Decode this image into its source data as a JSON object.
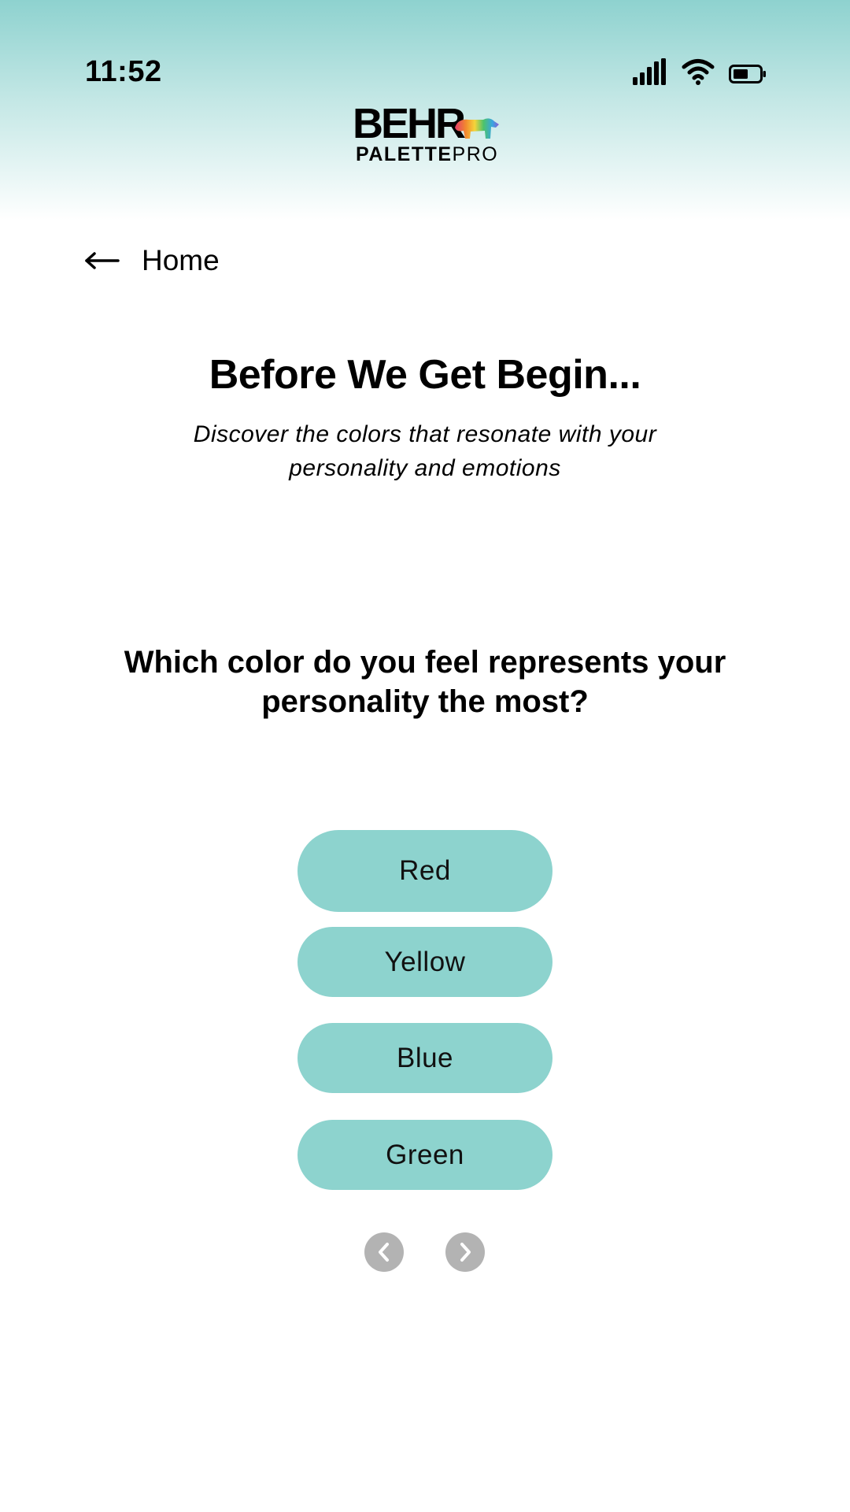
{
  "status_bar": {
    "time": "11:52",
    "icons": [
      "cellular-signal-icon",
      "wifi-icon",
      "battery-icon"
    ]
  },
  "header": {
    "logo": {
      "brand": "BEHR",
      "product_bold": "PALETTE",
      "product_light": "PRO"
    },
    "gradient_colors": [
      "#8ed2cf",
      "#ffffff"
    ]
  },
  "nav": {
    "back_label": "Home",
    "back_icon": "arrow-left-icon"
  },
  "intro": {
    "title": "Before We Get Begin...",
    "subtitle": "Discover the colors that resonate with your personality and emotions"
  },
  "quiz": {
    "question": "Which color do you feel represents your personality the most?",
    "options": [
      {
        "label": "Red"
      },
      {
        "label": "Yellow"
      },
      {
        "label": "Blue"
      },
      {
        "label": "Green"
      }
    ],
    "pager_icons": [
      "chevron-left-icon",
      "chevron-right-icon"
    ]
  },
  "colors": {
    "option_fill": "#8dd3ce",
    "pager_fill": "#b3b3b3",
    "text": "#000000"
  }
}
